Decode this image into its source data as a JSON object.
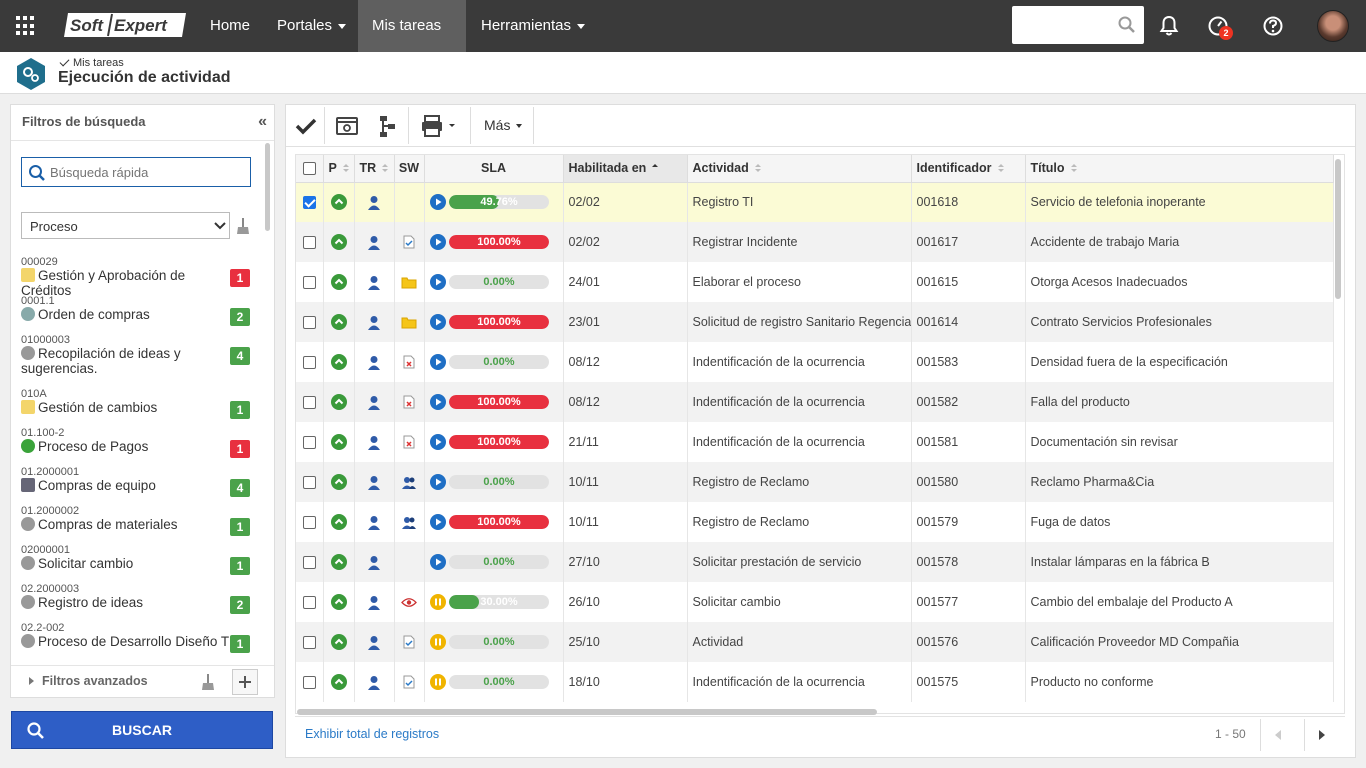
{
  "topbar": {
    "logo_text": "SoftExpert",
    "nav": [
      {
        "label": "Home",
        "dropdown": false
      },
      {
        "label": "Portales",
        "dropdown": true
      },
      {
        "label": "Mis tareas",
        "dropdown": true,
        "active": true
      },
      {
        "label": "Herramientas",
        "dropdown": true
      }
    ],
    "search_placeholder": "",
    "notification_count": "2"
  },
  "header": {
    "breadcrumb": "Mis tareas",
    "title": "Ejecución de actividad"
  },
  "filters": {
    "title": "Filtros de búsqueda",
    "quick_search_placeholder": "Búsqueda rápida",
    "select_value": "Proceso",
    "processes": [
      {
        "code": "000029",
        "name": "Gestión y Aprobación de Créditos",
        "count": "1",
        "color": "red",
        "icon": "approval-icon"
      },
      {
        "code": "0001.1",
        "name": "Orden de compras",
        "count": "2",
        "color": "green",
        "icon": "cart-icon"
      },
      {
        "code": "01000003",
        "name": "Recopilación de ideas y sugerencias.",
        "count": "4",
        "color": "green",
        "icon": "gear-icon"
      },
      {
        "code": "010A",
        "name": "Gestión de cambios",
        "count": "1",
        "color": "green",
        "icon": "approval-icon"
      },
      {
        "code": "01.100-2",
        "name": "Proceso de Pagos",
        "count": "1",
        "color": "red",
        "icon": "check-circle-icon"
      },
      {
        "code": "01.2000001",
        "name": "Compras de equipo",
        "count": "4",
        "color": "green",
        "icon": "monitor-icon"
      },
      {
        "code": "01.2000002",
        "name": "Compras de materiales",
        "count": "1",
        "color": "green",
        "icon": "gear-icon"
      },
      {
        "code": "02000001",
        "name": "Solicitar cambio",
        "count": "1",
        "color": "green",
        "icon": "gear-icon"
      },
      {
        "code": "02.2000003",
        "name": "Registro de ideas",
        "count": "2",
        "color": "green",
        "icon": "gear-icon"
      },
      {
        "code": "02.2-002",
        "name": "Proceso de Desarrollo Diseño T",
        "count": "1",
        "color": "green",
        "icon": "gear-icon"
      }
    ],
    "advanced_label": "Filtros avanzados",
    "search_button": "BUSCAR"
  },
  "toolbar": {
    "more_label": "Más"
  },
  "grid": {
    "columns": [
      "P",
      "TR",
      "SW",
      "SLA",
      "Habilitada en",
      "Actividad",
      "Identificador",
      "Título"
    ],
    "rows": [
      {
        "selected": true,
        "sw": "",
        "status": "play",
        "sla": 49.76,
        "sla_label": "49.76%",
        "sla_color": "green",
        "date": "02/02",
        "activity": "Registro TI",
        "id": "001618",
        "title": "Servicio de telefonia inoperante"
      },
      {
        "selected": false,
        "sw": "doc-check",
        "status": "play",
        "sla": 100,
        "sla_label": "100.00%",
        "sla_color": "red",
        "date": "02/02",
        "activity": "Registrar Incidente",
        "id": "001617",
        "title": "Accidente de trabajo Maria"
      },
      {
        "selected": false,
        "sw": "folder",
        "status": "play",
        "sla": 0,
        "sla_label": "0.00%",
        "sla_color": "green",
        "date": "24/01",
        "activity": "Elaborar el proceso",
        "id": "001615",
        "title": "Otorga Acesos Inadecuados"
      },
      {
        "selected": false,
        "sw": "folder",
        "status": "play",
        "sla": 100,
        "sla_label": "100.00%",
        "sla_color": "red",
        "date": "23/01",
        "activity": "Solicitud de registro Sanitario Regencia",
        "id": "001614",
        "title": "Contrato Servicios Profesionales"
      },
      {
        "selected": false,
        "sw": "doc-x",
        "status": "play",
        "sla": 0,
        "sla_label": "0.00%",
        "sla_color": "green",
        "date": "08/12",
        "activity": "Indentificación de la ocurrencia",
        "id": "001583",
        "title": "Densidad fuera de la especificación"
      },
      {
        "selected": false,
        "sw": "doc-x",
        "status": "play",
        "sla": 100,
        "sla_label": "100.00%",
        "sla_color": "red",
        "date": "08/12",
        "activity": "Indentificación de la ocurrencia",
        "id": "001582",
        "title": "Falla del producto"
      },
      {
        "selected": false,
        "sw": "doc-x",
        "status": "play",
        "sla": 100,
        "sla_label": "100.00%",
        "sla_color": "red",
        "date": "21/11",
        "activity": "Indentificación de la ocurrencia",
        "id": "001581",
        "title": "Documentación sin revisar"
      },
      {
        "selected": false,
        "sw": "users",
        "status": "play",
        "sla": 0,
        "sla_label": "0.00%",
        "sla_color": "green",
        "date": "10/11",
        "activity": "Registro de Reclamo",
        "id": "001580",
        "title": "Reclamo Pharma&Cia"
      },
      {
        "selected": false,
        "sw": "users",
        "status": "play",
        "sla": 100,
        "sla_label": "100.00%",
        "sla_color": "red",
        "date": "10/11",
        "activity": "Registro de Reclamo",
        "id": "001579",
        "title": "Fuga de datos"
      },
      {
        "selected": false,
        "sw": "",
        "status": "play",
        "sla": 0,
        "sla_label": "0.00%",
        "sla_color": "green",
        "date": "27/10",
        "activity": "Solicitar prestación de servicio",
        "id": "001578",
        "title": "Instalar lámparas en la fábrica B"
      },
      {
        "selected": false,
        "sw": "eye",
        "status": "pause",
        "sla": 30,
        "sla_label": "30.00%",
        "sla_color": "green",
        "date": "26/10",
        "activity": "Solicitar cambio",
        "id": "001577",
        "title": "Cambio del embalaje del Producto A"
      },
      {
        "selected": false,
        "sw": "doc-check",
        "status": "pause",
        "sla": 0,
        "sla_label": "0.00%",
        "sla_color": "green",
        "date": "25/10",
        "activity": "Actividad",
        "id": "001576",
        "title": "Calificación Proveedor MD Compañia"
      },
      {
        "selected": false,
        "sw": "doc-check",
        "status": "pause",
        "sla": 0,
        "sla_label": "0.00%",
        "sla_color": "green",
        "date": "18/10",
        "activity": "Indentificación de la ocurrencia",
        "id": "001575",
        "title": "Producto no conforme"
      }
    ],
    "show_total_label": "Exhibir total de registros",
    "page_range": "1 - 50"
  },
  "colors": {
    "green": "#4aa24a",
    "red": "#e8303f",
    "blue": "#1a73e8",
    "selected_row": "#fbfbd5"
  }
}
